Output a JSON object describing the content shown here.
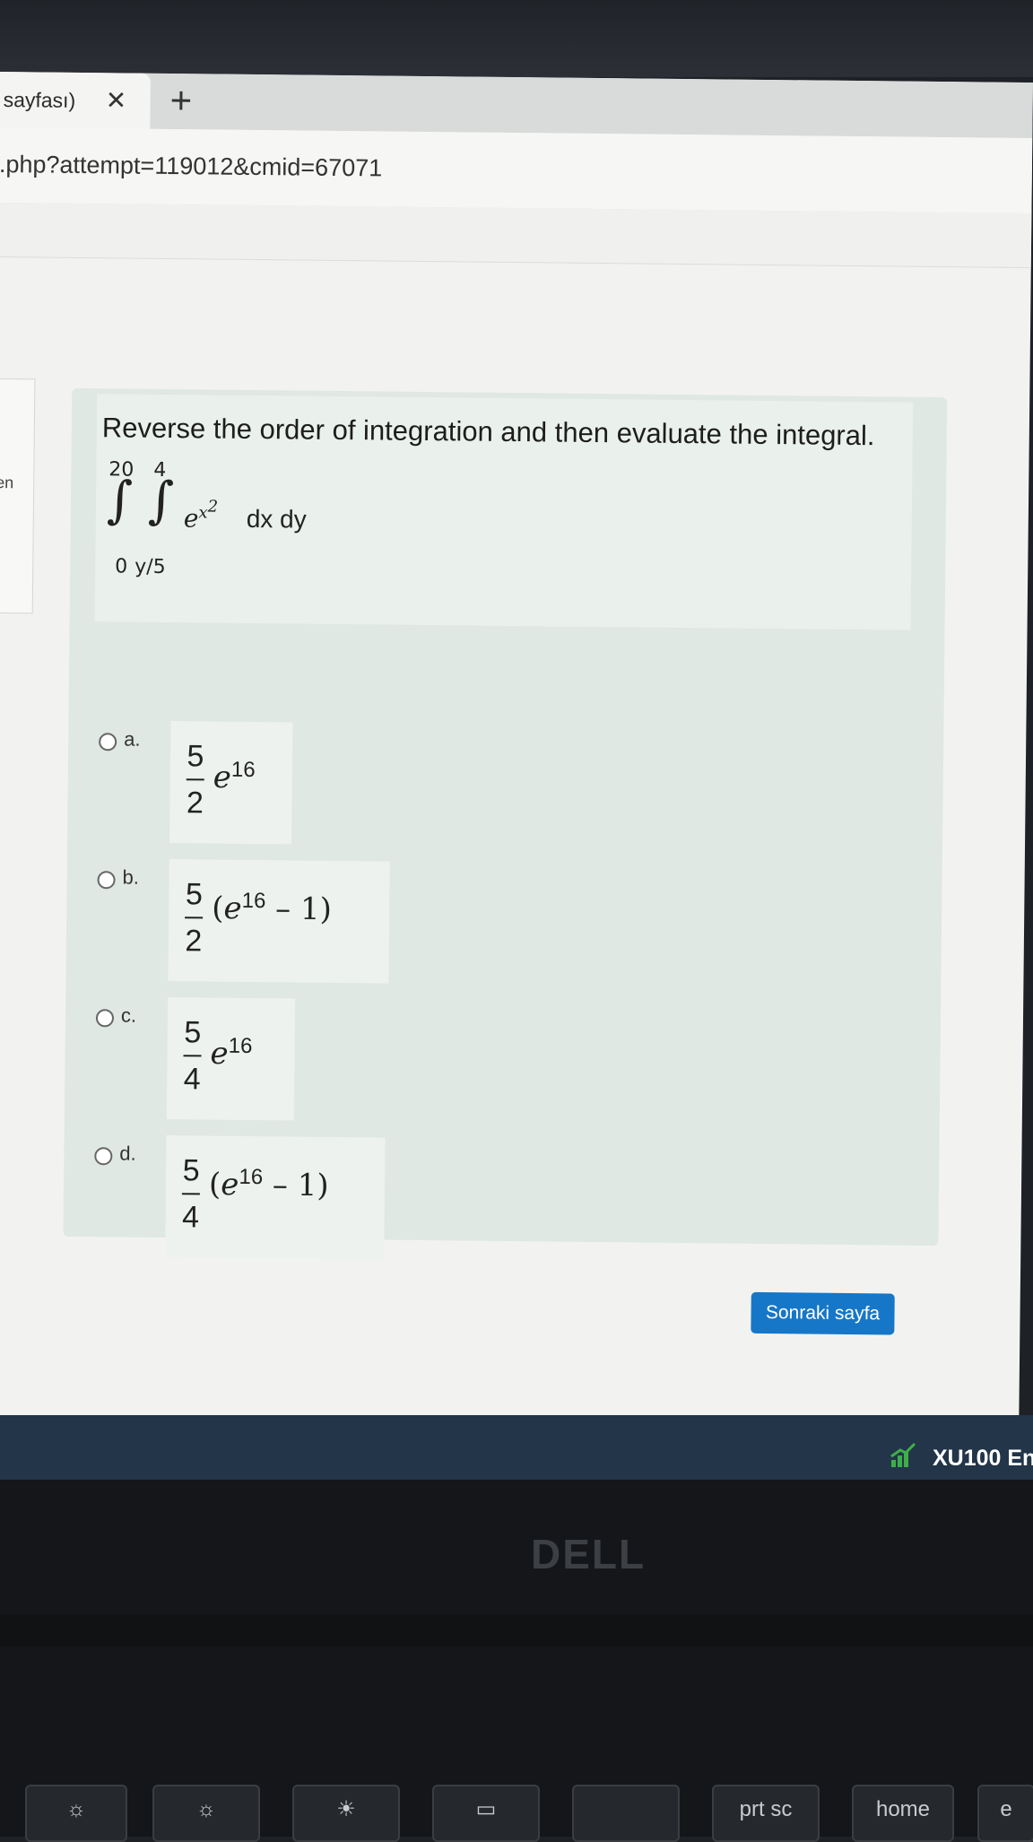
{
  "browser": {
    "tab_title": "sayfası)",
    "tab_close": "✕",
    "new_tab": "+",
    "url": ".php?attempt=119012&cmid=67071"
  },
  "sidebar": {
    "nav_text": "en"
  },
  "question": {
    "prompt": "Reverse the order of integration and then evaluate the integral.",
    "integral": {
      "outer_upper": "20",
      "outer_lower": "0",
      "inner_upper": "4",
      "inner_lower": "y/5",
      "integrand_base": "e",
      "integrand_exp": "x",
      "integrand_exp_power": "2",
      "differentials": "dx dy"
    },
    "options": [
      {
        "letter": "a.",
        "num": "5",
        "den": "2",
        "expr_pre": "",
        "base": "e",
        "power": "16",
        "expr_post": ""
      },
      {
        "letter": "b.",
        "num": "5",
        "den": "2",
        "expr_pre": "(",
        "base": "e",
        "power": "16",
        "expr_post": " – 1)"
      },
      {
        "letter": "c.",
        "num": "5",
        "den": "4",
        "expr_pre": "",
        "base": "e",
        "power": "16",
        "expr_post": ""
      },
      {
        "letter": "d.",
        "num": "5",
        "den": "4",
        "expr_pre": "(",
        "base": "e",
        "power": "16",
        "expr_post": " – 1)"
      }
    ]
  },
  "navigation": {
    "next_button": "Sonraki sayfa"
  },
  "taskbar": {
    "ticker": "XU100 En"
  },
  "laptop": {
    "brand": "DELL",
    "keys": [
      "prt sc",
      "home",
      "e"
    ]
  },
  "colors": {
    "primary_button": "#1677c8",
    "question_bg": "#dfe8e2",
    "taskbar": "#223549"
  }
}
